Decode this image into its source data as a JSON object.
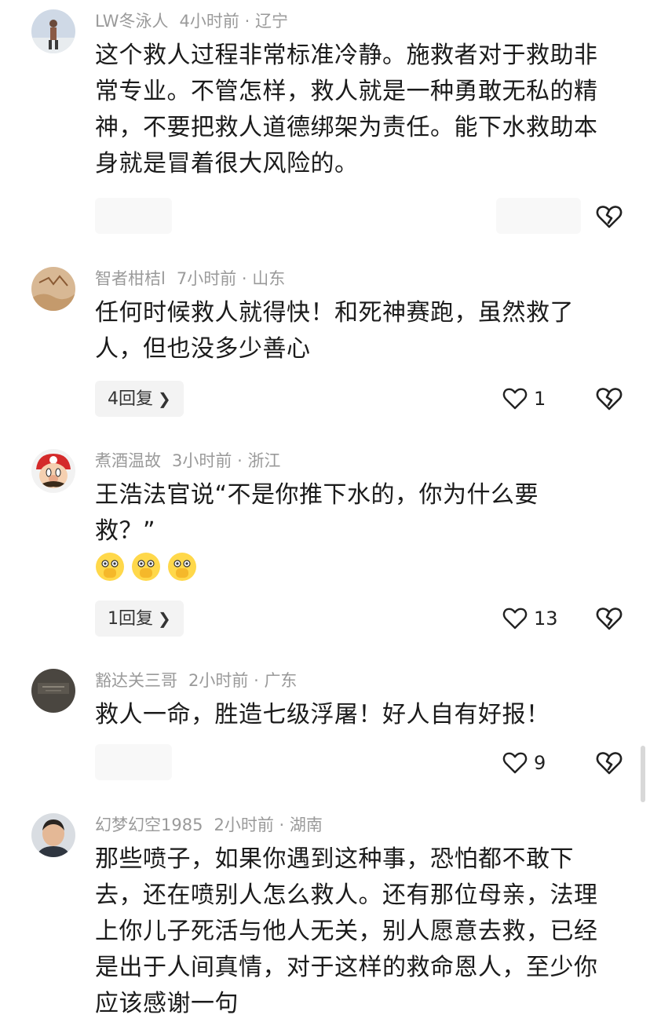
{
  "comments": [
    {
      "username": "LW冬泳人",
      "time": "4小时前",
      "location": "辽宁",
      "text": "这个救人过程非常标准冷静。施救者对于救助非常专业。不管怎样，救人就是一种勇敢无私的精神，不要把救人道德绑架为责任。能下水救助本身就是冒着很大风险的。",
      "likes": "",
      "reply_label": ""
    },
    {
      "username": "智者柑桔l",
      "time": "7小时前",
      "location": "山东",
      "text": "任何时候救人就得快！和死神赛跑，虽然救了人，但也没多少善心",
      "likes": "1",
      "reply_label": "4回复"
    },
    {
      "username": "煮酒温故",
      "time": "3小时前",
      "location": "浙江",
      "text": "王浩法官说“不是你推下水的，你为什么要救？”",
      "likes": "13",
      "reply_label": "1回复"
    },
    {
      "username": "豁达关三哥",
      "time": "2小时前",
      "location": "广东",
      "text": "救人一命，胜造七级浮屠！好人自有好报！",
      "likes": "9",
      "reply_label": ""
    },
    {
      "username": "幻梦幻空1985",
      "time": "2小时前",
      "location": "湖南",
      "text": "那些喷子，如果你遇到这种事，恐怕都不敢下去，还在喷别人怎么救人。还有那位母亲，法理上你儿子死活与他人无关，别人愿意去救，已经是出于人间真情，对于这样的救命恩人，至少你应该感谢一句",
      "likes": "",
      "reply_label": ""
    }
  ],
  "separator": "·",
  "colors": {
    "meta_gray": "#9a9a9a",
    "text": "#1b1b1b",
    "reply_bg": "#f3f3f3"
  },
  "icons": {
    "like": "heart-outline-icon",
    "dislike": "broken-heart-icon",
    "reply_arrow": "chevron-right-icon",
    "emoji": "peeking-face-emoji"
  }
}
